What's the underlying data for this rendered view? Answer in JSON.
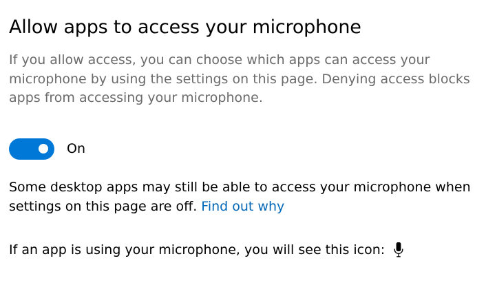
{
  "header": {
    "title": "Allow apps to access your microphone"
  },
  "description": "If you allow access, you can choose which apps can access your microphone by using the settings on this page. Denying access blocks apps from accessing your microphone.",
  "access_toggle": {
    "state": "On",
    "on": true,
    "accent_color": "#0078d7"
  },
  "desktop_note": {
    "text": "Some desktop apps may still be able to access your microphone when settings on this page are off.",
    "link_label": "Find out why",
    "link_color": "#0067b8"
  },
  "icon_line": {
    "text": "If an app is using your microphone, you will see this icon:",
    "icon": "microphone-icon"
  }
}
